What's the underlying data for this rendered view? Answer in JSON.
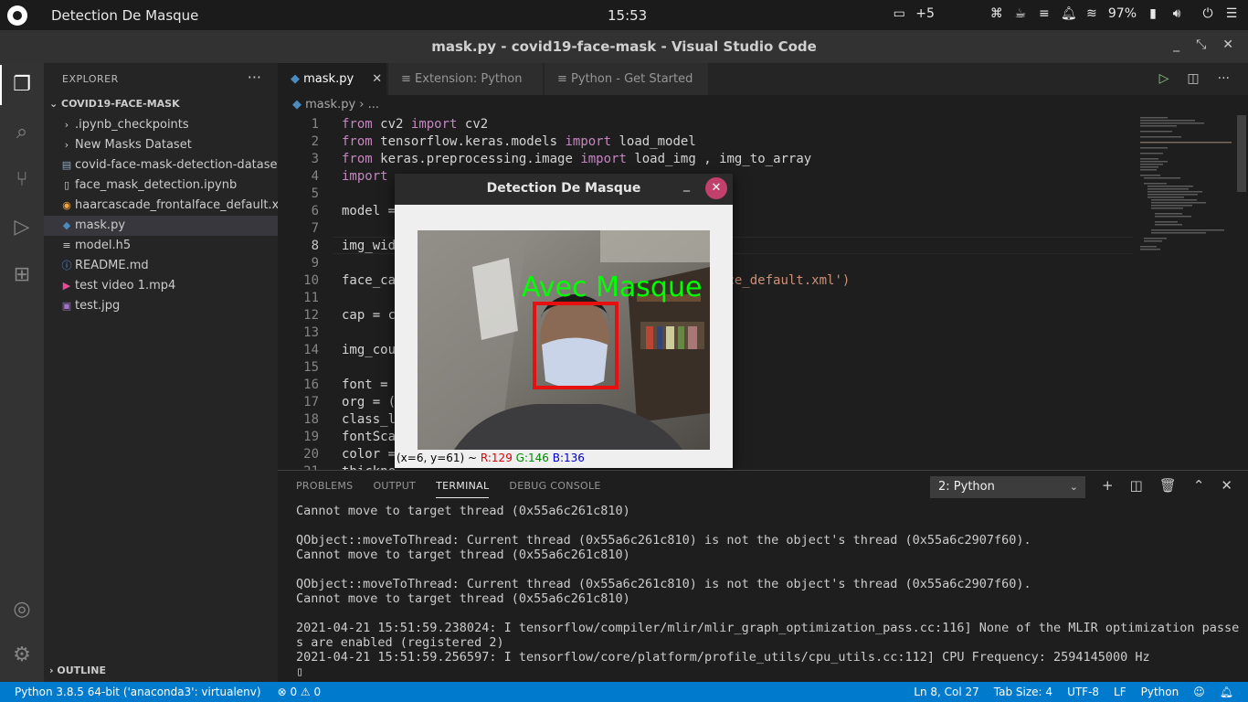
{
  "system": {
    "app_title": "Detection De Masque",
    "clock": "15:53",
    "notif_count": "+5",
    "battery": "97%"
  },
  "window": {
    "title": "mask.py - covid19-face-mask - Visual Studio Code"
  },
  "sidebar": {
    "header": "EXPLORER",
    "project": "COVID19-FACE-MASK",
    "items": [
      {
        "label": ".ipynb_checkpoints",
        "icon": "chevron-right",
        "color": "#cccccc"
      },
      {
        "label": "New Masks Dataset",
        "icon": "chevron-right",
        "color": "#cccccc"
      },
      {
        "label": "covid-face-mask-detection-dataset...",
        "icon": "file-zip",
        "color": "#8fa8c0"
      },
      {
        "label": "face_mask_detection.ipynb",
        "icon": "file-notebook",
        "color": "#cccccc"
      },
      {
        "label": "haarcascade_frontalface_default.x...",
        "icon": "file-rss",
        "color": "#f0a33c"
      },
      {
        "label": "mask.py",
        "icon": "python",
        "color": "#4b8bbe"
      },
      {
        "label": "model.h5",
        "icon": "file-lines",
        "color": "#cccccc"
      },
      {
        "label": "README.md",
        "icon": "info",
        "color": "#4a9df8"
      },
      {
        "label": "test video 1.mp4",
        "icon": "video",
        "color": "#e84c95"
      },
      {
        "label": "test.jpg",
        "icon": "image",
        "color": "#a074c4"
      }
    ],
    "outline": "OUTLINE"
  },
  "tabs": [
    {
      "label": "mask.py",
      "active": true
    },
    {
      "label": "Extension: Python",
      "active": false
    },
    {
      "label": "Python - Get Started",
      "active": false
    }
  ],
  "breadcrumb": {
    "file": "mask.py",
    "rest": "..."
  },
  "editor": {
    "line_numbers": [
      "1",
      "2",
      "3",
      "4",
      "5",
      "6",
      "7",
      "8",
      "9",
      "10",
      "11",
      "12",
      "13",
      "14",
      "15",
      "16",
      "17",
      "18",
      "19",
      "20",
      "21"
    ],
    "lines": [
      "from cv2 import cv2",
      "from tensorflow.keras.models import load_model",
      "from keras.preprocessing.image import load_img , img_to_array",
      "import",
      "",
      "model =",
      "",
      "img_wid",
      "",
      "face_ca                                  frontalface_default.xml')",
      "",
      "cap = c",
      "",
      "img_cou",
      "",
      "font = ",
      "org = (",
      "class_l",
      "fontSca",
      "color =",
      "thickne"
    ]
  },
  "cv_window": {
    "title": "Detection De Masque",
    "overlay_label": "Avec  Masque",
    "status_pos": "(x=6, y=61) ~ ",
    "status_r": "R:129",
    "status_g": "G:146",
    "status_b": "B:136"
  },
  "panel": {
    "tabs": [
      "PROBLEMS",
      "OUTPUT",
      "TERMINAL",
      "DEBUG CONSOLE"
    ],
    "active_tab": "TERMINAL",
    "terminal_select": "2: Python",
    "terminal_lines": [
      "Cannot move to target thread (0x55a6c261c810)",
      "",
      "QObject::moveToThread: Current thread (0x55a6c261c810) is not the object's thread (0x55a6c2907f60).",
      "Cannot move to target thread (0x55a6c261c810)",
      "",
      "QObject::moveToThread: Current thread (0x55a6c261c810) is not the object's thread (0x55a6c2907f60).",
      "Cannot move to target thread (0x55a6c261c810)",
      "",
      "2021-04-21 15:51:59.238024: I tensorflow/compiler/mlir/mlir_graph_optimization_pass.cc:116] None of the MLIR optimization passe",
      "s are enabled (registered 2)",
      "2021-04-21 15:51:59.256597: I tensorflow/core/platform/profile_utils/cpu_utils.cc:112] CPU Frequency: 2594145000 Hz",
      "▯"
    ]
  },
  "status": {
    "interpreter": "Python 3.8.5 64-bit ('anaconda3': virtualenv)",
    "problems": "⊗ 0 ⚠ 0",
    "position": "Ln 8, Col 27",
    "tab_size": "Tab Size: 4",
    "encoding": "UTF-8",
    "eol": "LF",
    "language": "Python"
  }
}
